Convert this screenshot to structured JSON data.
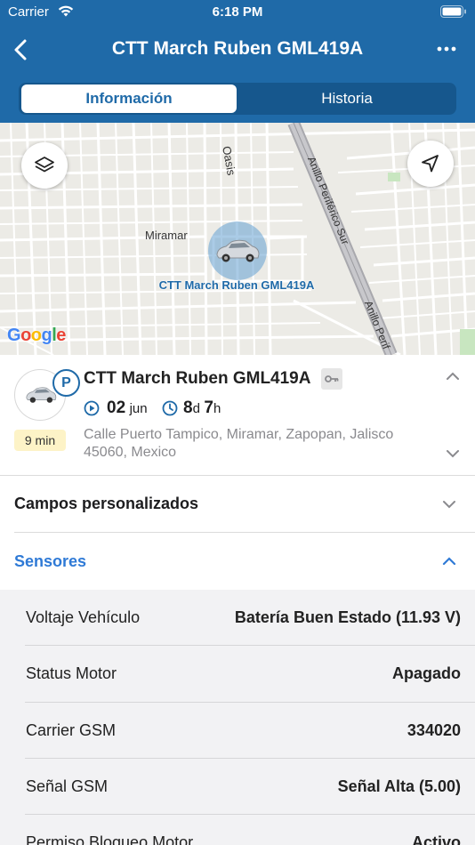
{
  "status_bar": {
    "carrier": "Carrier",
    "time": "6:18 PM"
  },
  "nav": {
    "title": "CTT March Ruben GML419A",
    "back_icon": "chevron-left-icon",
    "more_icon": "ellipsis-icon"
  },
  "tabs": [
    {
      "label": "Información",
      "active": true
    },
    {
      "label": "Historia",
      "active": false
    }
  ],
  "map": {
    "labels": {
      "oasis": "Oasis",
      "miramar": "Miramar",
      "anillo_sur": "Anillo Periférico Sur",
      "anillo_short": "Anillo Perif"
    },
    "marker_label": "CTT March Ruben GML419A",
    "google_logo": "Google",
    "layers_icon": "layers-icon",
    "locate_icon": "navigation-arrow-icon"
  },
  "vehicle": {
    "name": "CTT March Ruben GML419A",
    "status_badge": "P",
    "duration_badge": "9 min",
    "date_day": "02",
    "date_month": "jun",
    "duration_days": "8",
    "duration_days_unit": "d",
    "duration_hours": "7",
    "duration_hours_unit": "h",
    "address": "Calle Puerto Tampico, Miramar, Zapopan, Jalisco 45060, Mexico"
  },
  "sections": {
    "custom_fields": "Campos personalizados",
    "sensors": "Sensores"
  },
  "sensors": [
    {
      "name": "Voltaje Vehículo",
      "value": "Batería Buen Estado (11.93 V)"
    },
    {
      "name": "Status Motor",
      "value": "Apagado"
    },
    {
      "name": "Carrier GSM",
      "value": "334020"
    },
    {
      "name": "Señal GSM",
      "value": "Señal Alta (5.00)"
    },
    {
      "name": "Permiso Bloqueo Motor",
      "value": "Activo"
    }
  ],
  "colors": {
    "brand": "#1f6aa8",
    "link": "#2f7ad6",
    "badge_bg": "#fdf3c7"
  }
}
